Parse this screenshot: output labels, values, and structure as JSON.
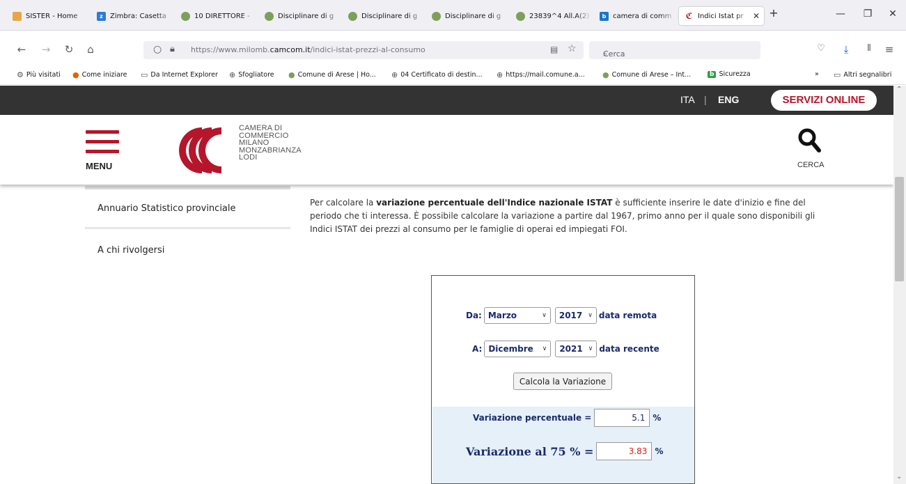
{
  "browser": {
    "tabs": [
      {
        "label": "SISTER - Home",
        "color": "#e8a64a"
      },
      {
        "label": "Zimbra: Casetta",
        "color": "#2d7bd6"
      },
      {
        "label": "10 DIRETTORE -",
        "color": "#7ba05b"
      },
      {
        "label": "Disciplinare di g",
        "color": "#7ba05b"
      },
      {
        "label": "Disciplinare di g",
        "color": "#7ba05b"
      },
      {
        "label": "Disciplinare di g",
        "color": "#7ba05b"
      },
      {
        "label": "23839^4 All.A(2)",
        "color": "#7ba05b"
      },
      {
        "label": "camera di comm",
        "color": "#1a76c5"
      },
      {
        "label": "Indici Istat pr",
        "color": "#b5162b"
      }
    ],
    "new_tab": "+",
    "window_controls": {
      "minimize": "—",
      "restore": "❐",
      "close": "✕"
    },
    "url": {
      "prefix": "https://www.milomb.",
      "domain": "camcom.it",
      "suffix": "/indici-istat-prezzi-al-consumo"
    },
    "search_placeholder": "Cerca",
    "bookmarks": [
      {
        "label": "Più visitati",
        "icon": "gear-icon"
      },
      {
        "label": "Come iniziare",
        "icon": "firefox-icon"
      },
      {
        "label": "Da Internet Explorer",
        "icon": "folder-icon"
      },
      {
        "label": "Sfogliatore",
        "icon": "globe-icon"
      },
      {
        "label": "Comune di Arese | Ho...",
        "icon": "crest-icon"
      },
      {
        "label": "04 Certificato di destin...",
        "icon": "globe-icon"
      },
      {
        "label": "https://mail.comune.a...",
        "icon": "globe-icon"
      },
      {
        "label": "Comune di Arese – Int...",
        "icon": "crest-icon"
      },
      {
        "label": "Sicurezza",
        "icon": "b-icon"
      }
    ],
    "other_bookmarks": "Altri segnalibri"
  },
  "site": {
    "lang_ita": "ITA",
    "lang_sep": "|",
    "lang_eng": "ENG",
    "servizi": "SERVIZI ONLINE",
    "menu": "MENU",
    "logo_lines": [
      "CAMERA DI",
      "COMMERCIO",
      "MILANO",
      "MONZABRIANZA",
      "LODI"
    ],
    "cerca": "CERCA",
    "brand_color": "#b5162b"
  },
  "sidebar": {
    "items": [
      "Annuario Statistico provinciale",
      "A chi rivolgersi"
    ]
  },
  "intro": {
    "part1": "Per calcolare la ",
    "bold": "variazione percentuale dell'Indice nazionale ISTAT",
    "part2": " è sufficiente inserire le date d'inizio e fine del periodo che ti interessa. È possibile calcolare la variazione a partire dal 1967, primo anno per il quale sono disponibili gli Indici ISTAT dei prezzi al consumo per le famiglie di operai ed impiegati FOI."
  },
  "calculator": {
    "from_label": "Da:",
    "from_month": "Marzo",
    "from_year": "2017",
    "from_note": "data remota",
    "to_label": "A:",
    "to_month": "Dicembre",
    "to_year": "2021",
    "to_note": "data recente",
    "button": "Calcola la Variazione",
    "var_label": "Variazione percentuale =",
    "var_value": "5.1",
    "var_unit": "%",
    "var75_label": "Variazione al 75 % =",
    "var75_value": "3.83",
    "var75_unit": "%"
  }
}
